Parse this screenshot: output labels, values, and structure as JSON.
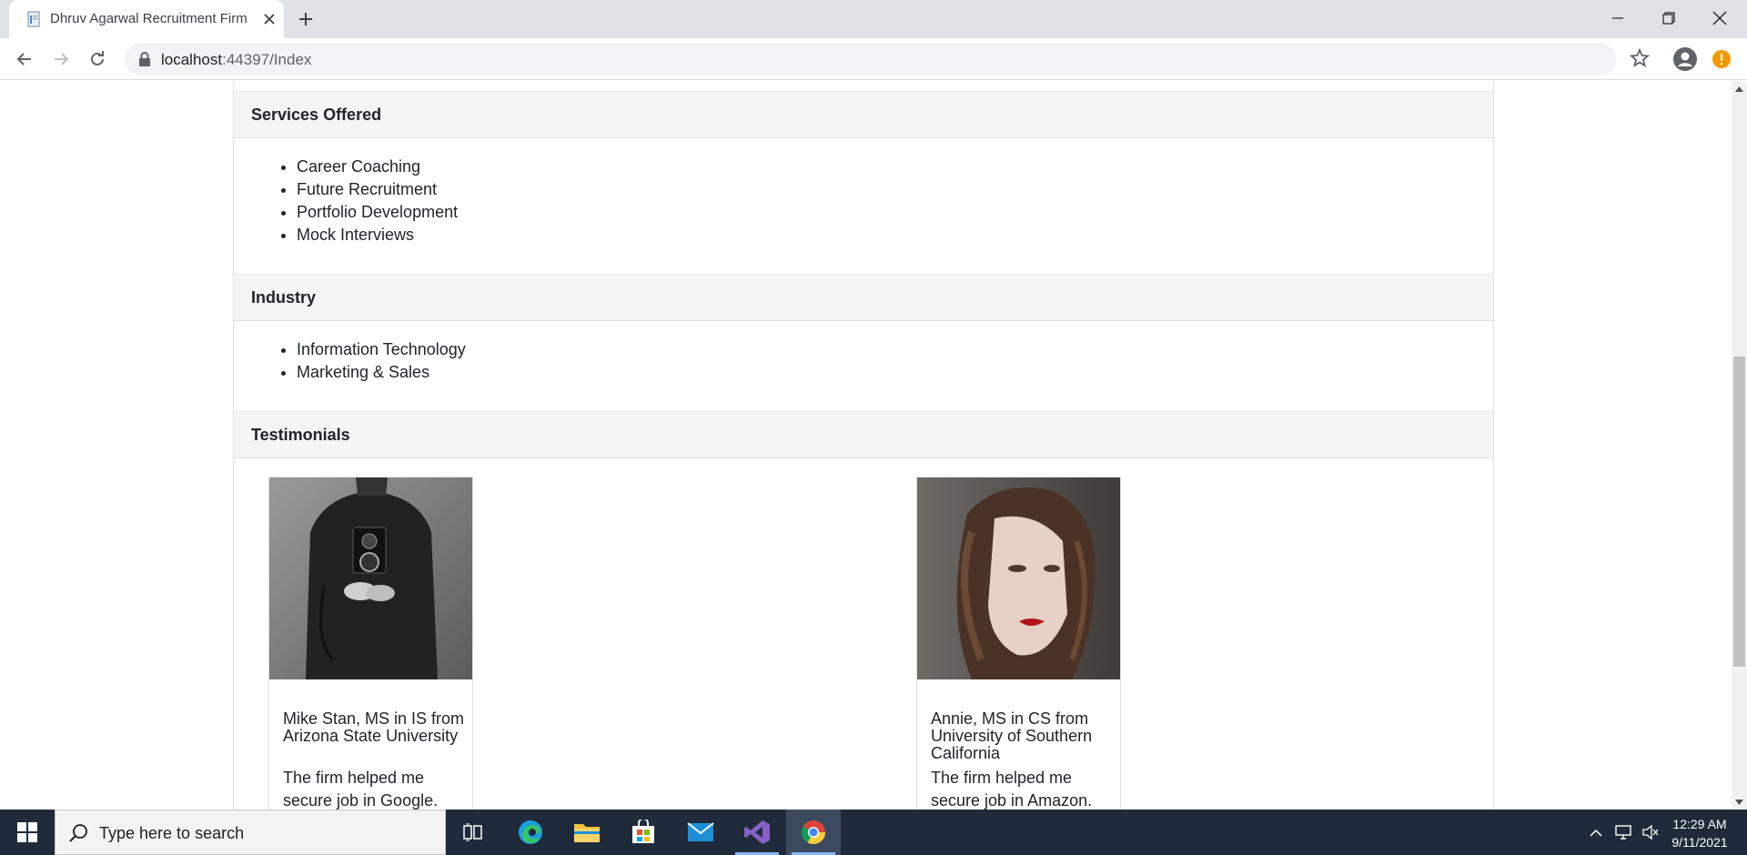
{
  "browser": {
    "tab_title": "Dhruv Agarwal Recruitment Firm",
    "url_host": "localhost",
    "url_path": ":44397/Index"
  },
  "sections": {
    "services": {
      "title": "Services Offered",
      "items": [
        "Career Coaching",
        "Future Recruitment",
        "Portfolio Development",
        "Mock Interviews"
      ]
    },
    "industry": {
      "title": "Industry",
      "items": [
        "Information Technology",
        "Marketing & Sales"
      ]
    },
    "testimonials": {
      "title": "Testimonials",
      "items": [
        {
          "name": "Mike Stan, MS in IS from Arizona State University",
          "quote": "The firm helped me secure job in Google."
        },
        {
          "name": "Annie, MS in CS from University of Southern California",
          "quote": "The firm helped me secure job in Amazon."
        }
      ]
    }
  },
  "taskbar": {
    "search_placeholder": "Type here to search",
    "time": "12:29 AM",
    "date": "9/11/2021"
  },
  "colors": {
    "taskbar_bg": "#1f2b3a",
    "section_header_bg": "#f5f5f5",
    "alert_badge": "#f29900"
  }
}
